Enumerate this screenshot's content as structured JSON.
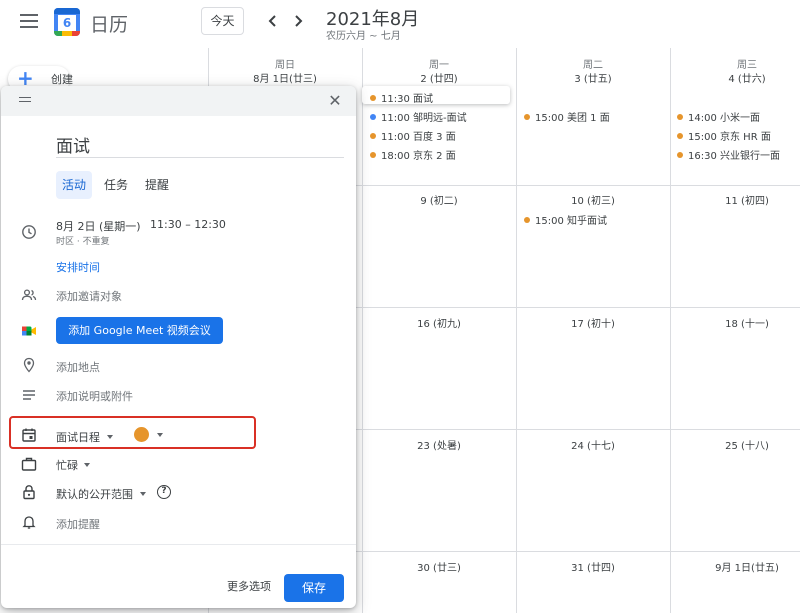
{
  "header": {
    "app_title": "日历",
    "logo_day": "6",
    "today_label": "今天",
    "month_title": "2021年8月",
    "lunar_subtitle": "农历六月 ~ 七月"
  },
  "create": {
    "label": "创建"
  },
  "calendar": {
    "days": [
      {
        "weekday": "周日",
        "date": "8月 1日(廿三)"
      },
      {
        "weekday": "周一",
        "date": "2 (廿四)"
      },
      {
        "weekday": "周二",
        "date": "3 (廿五)"
      },
      {
        "weekday": "周三",
        "date": "4 (廿六)"
      }
    ],
    "weeks": [
      [
        "9 (初二)",
        "10 (初三)",
        "11 (初四)"
      ],
      [
        "16 (初九)",
        "17 (初十)",
        "18 (十一)"
      ],
      [
        "23 (处暑)",
        "24 (十七)",
        "25 (十八)"
      ],
      [
        "30 (廿三)",
        "31 (廿四)",
        "9月 1日(廿五)"
      ]
    ],
    "events": {
      "mon_1": "11:30 面试",
      "mon_2": "11:00 邹明远-面试",
      "mon_3": "11:00 百度 3 面",
      "mon_4": "18:00 京东 2 面",
      "tue_1": "15:00 美团 1 面",
      "wed_1": "14:00 小米一面",
      "wed_2": "15:00 京东 HR 面",
      "wed_3": "16:30 兴业银行一面",
      "tue_wk2": "15:00 知乎面试"
    },
    "colors": {
      "orange": "#e6952c",
      "blue": "#4285f4"
    }
  },
  "dialog": {
    "title_value": "面试",
    "tabs": [
      "活动",
      "任务",
      "提醒"
    ],
    "date": "8月 2日 (星期一)",
    "time_range": "11:30  –  12:30",
    "timezone_note": "时区 · 不重复",
    "schedule_link": "安排时间",
    "add_guests": "添加邀请对象",
    "meet_button": "添加 Google Meet 视频会议",
    "add_location": "添加地点",
    "add_description": "添加说明或附件",
    "calendar_name": "面试日程",
    "event_color": "#e6952c",
    "busy_status": "忙碌",
    "visibility": "默认的公开范围",
    "help": "?",
    "add_notification": "添加提醒",
    "more_options": "更多选项",
    "save": "保存",
    "close": "✕"
  }
}
